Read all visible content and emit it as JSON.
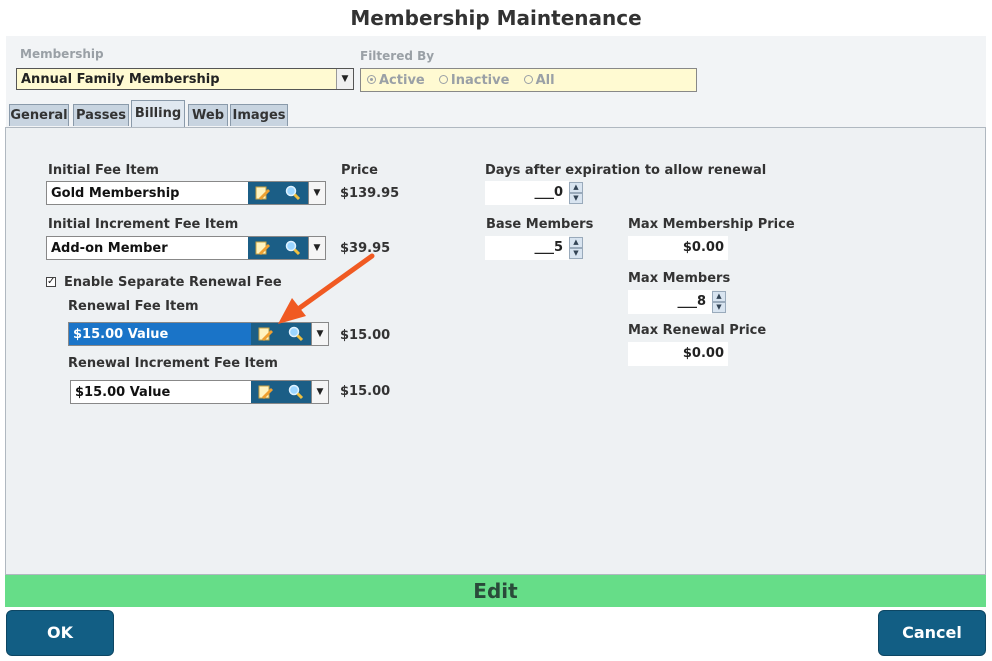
{
  "window": {
    "title": "Membership Maintenance"
  },
  "membership": {
    "label": "Membership",
    "value": "Annual Family Membership"
  },
  "filter": {
    "label": "Filtered By",
    "options": [
      "Active",
      "Inactive",
      "All"
    ],
    "selected": "Active"
  },
  "tabs": [
    {
      "label": "General"
    },
    {
      "label": "Passes"
    },
    {
      "label": "Billing",
      "active": true
    },
    {
      "label": "Web"
    },
    {
      "label": "Images"
    }
  ],
  "billing": {
    "initial_fee": {
      "label": "Initial Fee Item",
      "value": "Gold Membership",
      "price": "$139.95"
    },
    "price_label": "Price",
    "initial_increment": {
      "label": "Initial Increment Fee Item",
      "value": "Add-on Member",
      "price": "$39.95"
    },
    "enable_renewal": {
      "label": "Enable Separate Renewal Fee",
      "checked": true,
      "mark": "✓"
    },
    "renewal_fee": {
      "label": "Renewal Fee Item",
      "value": "$15.00 Value",
      "price": "$15.00"
    },
    "renewal_increment": {
      "label": "Renewal Increment Fee Item",
      "value": "$15.00 Value",
      "price": "$15.00"
    },
    "days_after": {
      "label": "Days after expiration to allow renewal",
      "value": "___0"
    },
    "base_members": {
      "label": "Base Members",
      "value": "___5"
    },
    "max_price": {
      "label": "Max Membership Price",
      "value": "$0.00"
    },
    "max_members": {
      "label": "Max Members",
      "value": "___8"
    },
    "max_renewal": {
      "label": "Max Renewal Price",
      "value": "$0.00"
    }
  },
  "status": {
    "mode": "Edit"
  },
  "buttons": {
    "ok": "OK",
    "cancel": "Cancel"
  },
  "colors": {
    "accent": "#125e84",
    "edit_bar": "#66dd88",
    "highlight": "#1a74c8",
    "arrow": "#f05a22"
  }
}
